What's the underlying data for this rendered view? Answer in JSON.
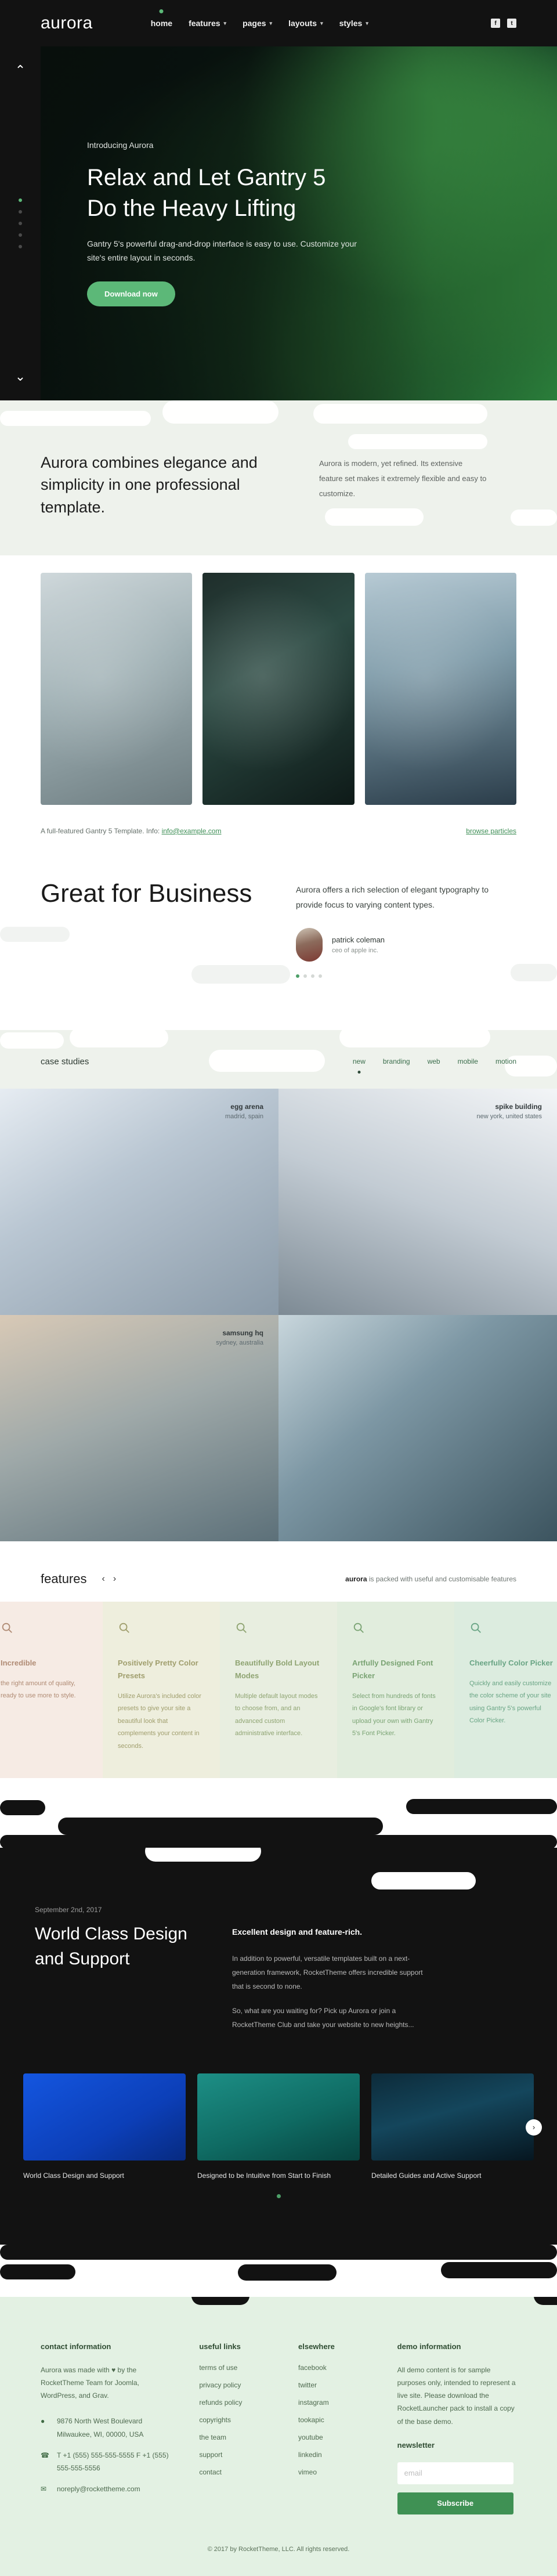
{
  "header": {
    "logo": "aurora",
    "nav": [
      {
        "label": "home",
        "caret": false,
        "active": true
      },
      {
        "label": "features",
        "caret": true,
        "active": false
      },
      {
        "label": "pages",
        "caret": true,
        "active": false
      },
      {
        "label": "layouts",
        "caret": true,
        "active": false
      },
      {
        "label": "styles",
        "caret": true,
        "active": false
      }
    ],
    "social": [
      {
        "name": "facebook-icon",
        "glyph": "f"
      },
      {
        "name": "twitter-icon",
        "glyph": "t"
      }
    ]
  },
  "hero": {
    "up_arrow": "⌃",
    "down_arrow": "⌄",
    "kicker": "Introducing Aurora",
    "title": "Relax and Let Gantry 5 Do the Heavy Lifting",
    "subtitle": "Gantry 5's powerful drag-and-drop interface is easy to use. Customize your site's entire layout in seconds.",
    "button": "Download now",
    "slide_labels": [
      "1",
      "2",
      "3",
      "4",
      "5"
    ]
  },
  "intro": {
    "heading": "Aurora combines elegance and simplicity in one professional template.",
    "paragraph": "Aurora is modern, yet refined. Its extensive feature set makes it extremely flexible and easy to customize."
  },
  "infobar": {
    "text": "A full-featured Gantry 5 Template. Info:",
    "email": "info@example.com",
    "browse_link": "browse particles"
  },
  "business": {
    "heading": "Great for Business",
    "quote": "Aurora offers a rich selection of elegant typography to provide focus to varying content types.",
    "author_name": "patrick coleman",
    "author_role": "ceo of apple inc.",
    "dots": 4,
    "active_dot": 0
  },
  "cases": {
    "title": "case studies",
    "filters": [
      {
        "label": "new",
        "active": true
      },
      {
        "label": "branding",
        "active": false
      },
      {
        "label": "web",
        "active": false
      },
      {
        "label": "mobile",
        "active": false
      },
      {
        "label": "motion",
        "active": false
      }
    ],
    "items": [
      {
        "title": "egg arena",
        "location": "madrid, spain",
        "align": "right"
      },
      {
        "title": "spike building",
        "location": "new york, united states",
        "align": "right"
      },
      {
        "title": "samsung hq",
        "location": "sydney, australia",
        "align": "right"
      },
      {
        "title": "",
        "location": "",
        "align": "right"
      }
    ]
  },
  "features": {
    "title": "features",
    "prev": "‹",
    "next": "›",
    "note_brand": "aurora",
    "note_rest": " is packed with useful and customisable features",
    "icon": "search-icon",
    "cards": [
      {
        "heading": "Incredible",
        "body": "the right amount of quality, ready to use more to style."
      },
      {
        "heading": "Positively Pretty Color Presets",
        "body": "Utilize Aurora's included color presets to give your site a beautiful look that complements your content in seconds."
      },
      {
        "heading": "Beautifully Bold Layout Modes",
        "body": "Multiple default layout modes to choose from, and an advanced custom administrative interface."
      },
      {
        "heading": "Artfully Designed Font Picker",
        "body": "Select from hundreds of fonts in Google's font library or upload your own with Gantry 5's Font Picker."
      },
      {
        "heading": "Cheerfully Color Picker",
        "body": "Quickly and easily customize the color scheme of your site using Gantry 5's powerful Color Picker."
      }
    ]
  },
  "dark": {
    "date": "September 2nd, 2017",
    "heading": "World Class Design and Support",
    "lead": "Excellent design and feature-rich.",
    "paragraph_1": "In addition to powerful, versatile templates built on a next-generation framework, RocketTheme offers incredible support that is second to none.",
    "paragraph_2": "So, what are you waiting for? Pick up Aurora or join a RocketTheme Club and take your website to new heights...",
    "next_arrow": "›",
    "tiles": [
      {
        "caption": "World Class Design and Support"
      },
      {
        "caption": "Designed to be Intuitive from Start to Finish"
      },
      {
        "caption": "Detailed Guides and Active Support"
      }
    ]
  },
  "footer": {
    "contact": {
      "heading": "contact information",
      "blurb_before": "Aurora was made with ",
      "heart": "♥",
      "blurb_after": " by the RocketTheme Team for Joomla, WordPress, and Grav.",
      "address_icon": "location-pin-icon",
      "address": "9876 North West Boulevard Milwaukee, WI, 00000, USA",
      "phone_icon": "phone-icon",
      "phone": "T +1 (555) 555-555-5555 F +1 (555) 555-555-5556",
      "email_icon": "envelope-icon",
      "email": "noreply@rockettheme.com"
    },
    "useful_links": {
      "heading": "useful links",
      "links": [
        "terms of use",
        "privacy policy",
        "refunds policy",
        "copyrights",
        "the team",
        "support",
        "contact"
      ]
    },
    "elsewhere": {
      "heading": "elsewhere",
      "links": [
        "facebook",
        "twitter",
        "instagram",
        "tookapic",
        "youtube",
        "linkedin",
        "vimeo"
      ]
    },
    "demo": {
      "heading": "demo information",
      "text": "All demo content is for sample purposes only, intended to represent a live site. Please download the RocketLauncher pack to install a copy of the base demo.",
      "newsletter_heading": "newsletter",
      "email_placeholder": "email",
      "email_value": "",
      "subscribe_label": "Subscribe"
    },
    "copyright": "© 2017 by RocketTheme, LLC. All rights reserved."
  },
  "colors": {
    "accent": "#5cb878",
    "dark": "#121212",
    "mint": "#e3f1e3",
    "pale": "#eef2ec"
  }
}
